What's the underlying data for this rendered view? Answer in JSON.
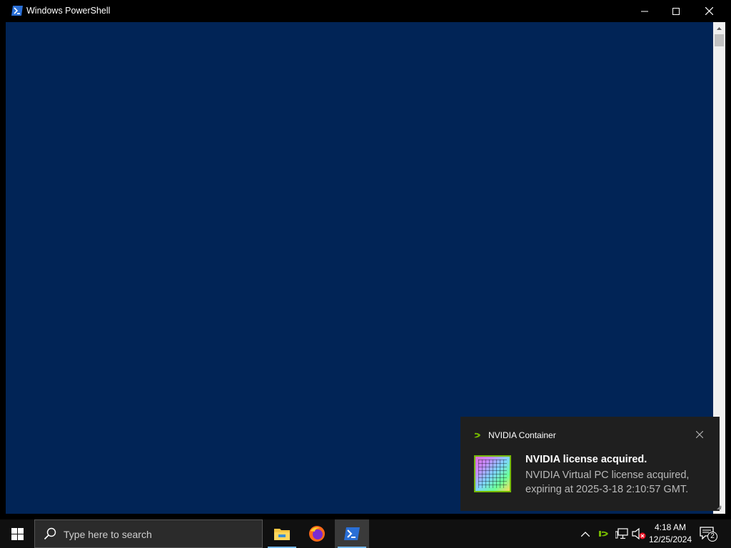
{
  "window": {
    "title": "Windows PowerShell",
    "console_background": "#012456",
    "icons": [
      "powershell-icon",
      "minimize-icon",
      "maximize-icon",
      "close-icon"
    ]
  },
  "toast": {
    "app_name": "NVIDIA Container",
    "title": "NVIDIA license acquired.",
    "body": "NVIDIA Virtual PC license acquired, expiring at 2025-3-18 2:10:57 GMT.",
    "accent": "#76b900"
  },
  "taskbar": {
    "search_placeholder": "Type here to search",
    "apps": [
      "file-explorer",
      "firefox",
      "windows-powershell"
    ],
    "active_app": "windows-powershell",
    "clock": {
      "time": "4:18 AM",
      "date": "12/25/2024"
    },
    "notification_count": "2"
  }
}
